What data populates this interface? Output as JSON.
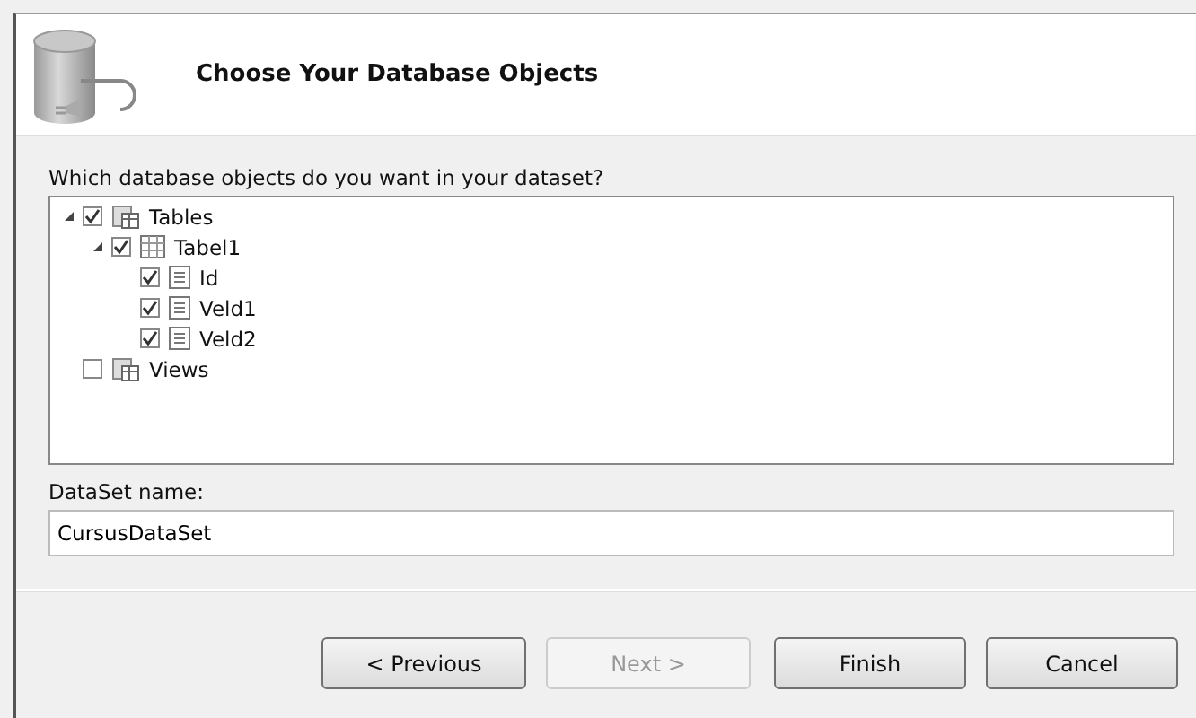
{
  "header": {
    "title": "Choose Your Database Objects"
  },
  "prompt": "Which database objects do you want in your dataset?",
  "tree": [
    {
      "label": "Tables",
      "kind": "folder",
      "checked": true,
      "expanded": true,
      "children": [
        {
          "label": "Tabel1",
          "kind": "table",
          "checked": true,
          "expanded": true,
          "children": [
            {
              "label": "Id",
              "kind": "field",
              "checked": true
            },
            {
              "label": "Veld1",
              "kind": "field",
              "checked": true
            },
            {
              "label": "Veld2",
              "kind": "field",
              "checked": true
            }
          ]
        }
      ]
    },
    {
      "label": "Views",
      "kind": "folder",
      "checked": false
    }
  ],
  "dataset": {
    "label": "DataSet name:",
    "value": "CursusDataSet"
  },
  "buttons": [
    {
      "label": "< Previous",
      "disabled": false
    },
    {
      "label": "Next >",
      "disabled": true
    },
    {
      "label": "Finish",
      "disabled": false
    },
    {
      "label": "Cancel",
      "disabled": false
    }
  ]
}
